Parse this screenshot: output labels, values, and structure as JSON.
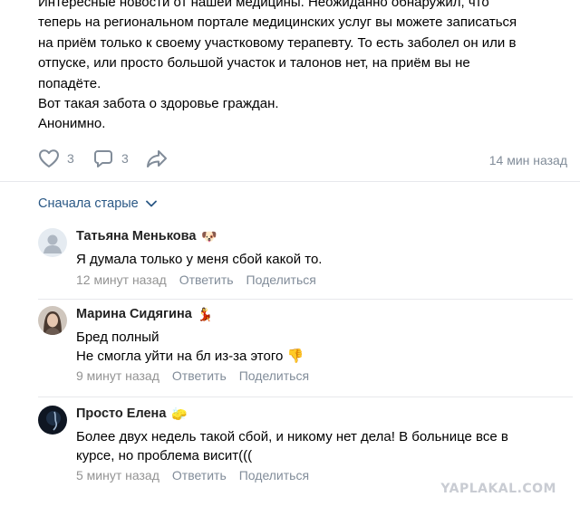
{
  "post": {
    "lines": [
      "Интересные новости от нашей медицины. Неожиданно обнаружил, что",
      "теперь на региональном портале медицинских услуг вы можете записаться",
      "на приём только к своему участковому терапевту. То есть заболел он или в",
      "отпуске, или просто большой участок и талонов нет, на приём вы не",
      "попадёте.",
      "Вот такая забота о здоровье граждан.",
      "Анонимно."
    ],
    "likes": "3",
    "comments": "3",
    "time": "14 мин назад"
  },
  "sort": {
    "label": "Сначала старые"
  },
  "comments": [
    {
      "author": "Татьяна Менькова",
      "emoji": "🐶",
      "text": [
        "Я думала только у меня сбой какой то."
      ],
      "time": "12 минут назад",
      "reply": "Ответить",
      "share": "Поделиться"
    },
    {
      "author": "Марина Сидягина",
      "emoji": "💃",
      "text": [
        "Бред полный",
        "Не смогла уйти на бл из-за этого 👎"
      ],
      "time": "9 минут назад",
      "reply": "Ответить",
      "share": "Поделиться"
    },
    {
      "author": "Просто Елена",
      "emoji": "🧽",
      "text": [
        "Более двух недель такой сбой, и никому нет дела! В больнице все в",
        "курсе, но проблема висит((("
      ],
      "time": "5 минут назад",
      "reply": "Ответить",
      "share": "Поделиться"
    }
  ],
  "watermark": "YAPLAKAL.COM",
  "colors": {
    "link": "#2a5885",
    "muted": "#818c99",
    "divider": "#e7e8ec"
  }
}
